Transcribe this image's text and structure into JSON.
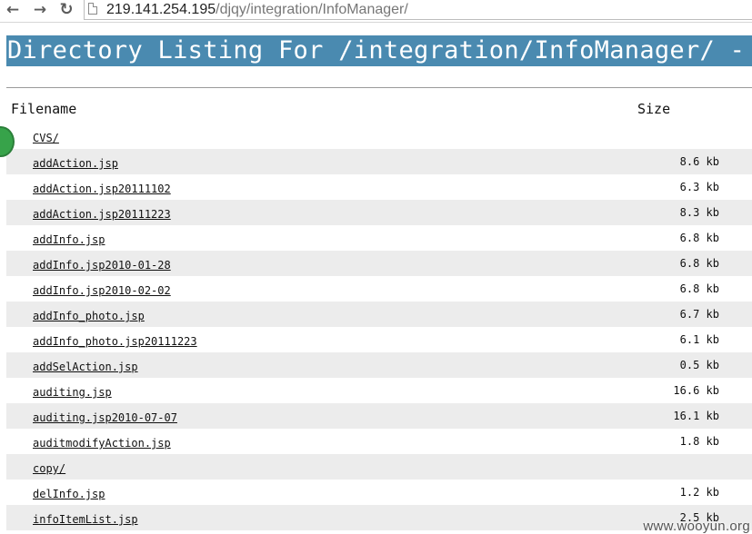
{
  "browser": {
    "url_host": "219.141.254.195",
    "url_path": "/djqy/integration/InfoManager/"
  },
  "page": {
    "heading": "Directory Listing For /integration/InfoManager/ -",
    "column_filename": "Filename",
    "column_size": "Size"
  },
  "files": [
    {
      "name": "CVS/",
      "size": ""
    },
    {
      "name": "addAction.jsp",
      "size": "8.6 kb"
    },
    {
      "name": "addAction.jsp20111102",
      "size": "6.3 kb"
    },
    {
      "name": "addAction.jsp20111223",
      "size": "8.3 kb"
    },
    {
      "name": "addInfo.jsp",
      "size": "6.8 kb"
    },
    {
      "name": "addInfo.jsp2010-01-28",
      "size": "6.8 kb"
    },
    {
      "name": "addInfo.jsp2010-02-02",
      "size": "6.8 kb"
    },
    {
      "name": "addInfo_photo.jsp",
      "size": "6.7 kb"
    },
    {
      "name": "addInfo_photo.jsp20111223",
      "size": "6.1 kb"
    },
    {
      "name": "addSelAction.jsp",
      "size": "0.5 kb"
    },
    {
      "name": "auditing.jsp",
      "size": "16.6 kb"
    },
    {
      "name": "auditing.jsp2010-07-07",
      "size": "16.1 kb"
    },
    {
      "name": "auditmodifyAction.jsp",
      "size": "1.8 kb"
    },
    {
      "name": "copy/",
      "size": ""
    },
    {
      "name": "delInfo.jsp",
      "size": "1.2 kb"
    },
    {
      "name": "infoItemList.jsp",
      "size": "2.5 kb"
    }
  ],
  "watermark": "www.wooyun.org",
  "colors": {
    "heading_bg": "#4a8ab0",
    "row_shade": "#ececec",
    "accent_dot": "#37a34a"
  }
}
